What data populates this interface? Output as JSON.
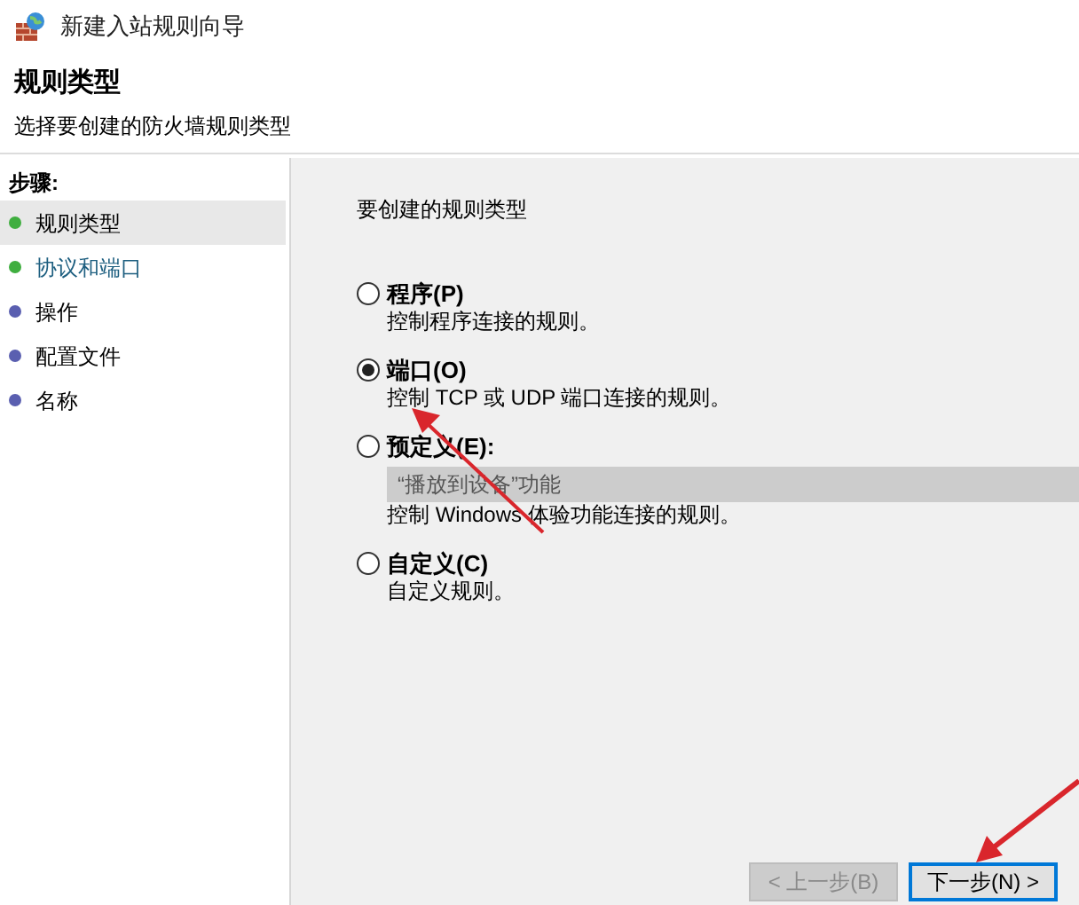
{
  "window": {
    "title": "新建入站规则向导"
  },
  "header": {
    "title": "规则类型",
    "subtitle": "选择要创建的防火墙规则类型"
  },
  "steps": {
    "heading": "步骤:",
    "items": [
      {
        "label": "规则类型",
        "selected": true,
        "color": "#3fae3f"
      },
      {
        "label": "协议和端口",
        "selected": false,
        "color": "#3fae3f"
      },
      {
        "label": "操作",
        "selected": false,
        "color": "#5a5fb0"
      },
      {
        "label": "配置文件",
        "selected": false,
        "color": "#5a5fb0"
      },
      {
        "label": "名称",
        "selected": false,
        "color": "#5a5fb0"
      }
    ]
  },
  "content": {
    "heading": "要创建的规则类型",
    "options": [
      {
        "label": "程序(P)",
        "description": "控制程序连接的规则。",
        "selected": false
      },
      {
        "label": "端口(O)",
        "description": "控制 TCP 或 UDP 端口连接的规则。",
        "selected": true
      },
      {
        "label": "预定义(E):",
        "dropdown": "“播放到设备”功能",
        "description": "控制 Windows 体验功能连接的规则。",
        "selected": false
      },
      {
        "label": "自定义(C)",
        "description": "自定义规则。",
        "selected": false
      }
    ]
  },
  "buttons": [
    {
      "label": "< 上一步(B)",
      "disabled": true,
      "selected": false
    },
    {
      "label": "下一步(N) >",
      "disabled": false,
      "selected": true
    }
  ]
}
